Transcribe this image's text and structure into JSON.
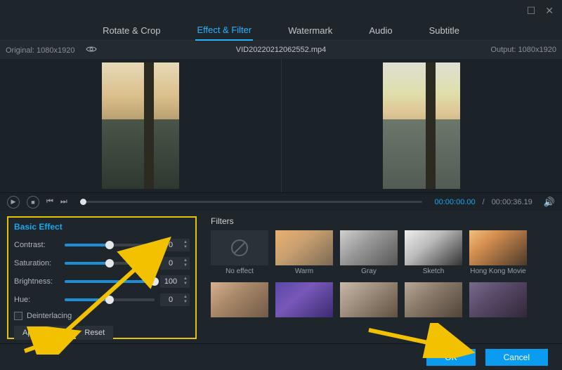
{
  "window": {
    "max_icon": "☐",
    "close_icon": "✕"
  },
  "tabs": {
    "rotate": "Rotate & Crop",
    "effect": "Effect & Filter",
    "watermark": "Watermark",
    "audio": "Audio",
    "subtitle": "Subtitle"
  },
  "infobar": {
    "original_label": "Original: 1080x1920",
    "filename": "VID20220212062552.mp4",
    "output_label": "Output: 1080x1920"
  },
  "playback": {
    "current": "00:00:00.00",
    "sep": "/",
    "duration": "00:00:36.19"
  },
  "basic_effect": {
    "title": "Basic Effect",
    "contrast": {
      "label": "Contrast:",
      "value": "0",
      "pct": 50
    },
    "saturation": {
      "label": "Saturation:",
      "value": "0",
      "pct": 50
    },
    "brightness": {
      "label": "Brightness:",
      "value": "100",
      "pct": 100
    },
    "hue": {
      "label": "Hue:",
      "value": "0",
      "pct": 50
    },
    "deinterlacing": "Deinterlacing",
    "apply_all": "Apply to All",
    "reset": "Reset"
  },
  "filters": {
    "title": "Filters",
    "no_effect": "No effect",
    "items": [
      {
        "label": "Warm"
      },
      {
        "label": "Gray"
      },
      {
        "label": "Sketch"
      },
      {
        "label": "Hong Kong Movie"
      }
    ]
  },
  "footer": {
    "ok": "OK",
    "cancel": "Cancel"
  }
}
